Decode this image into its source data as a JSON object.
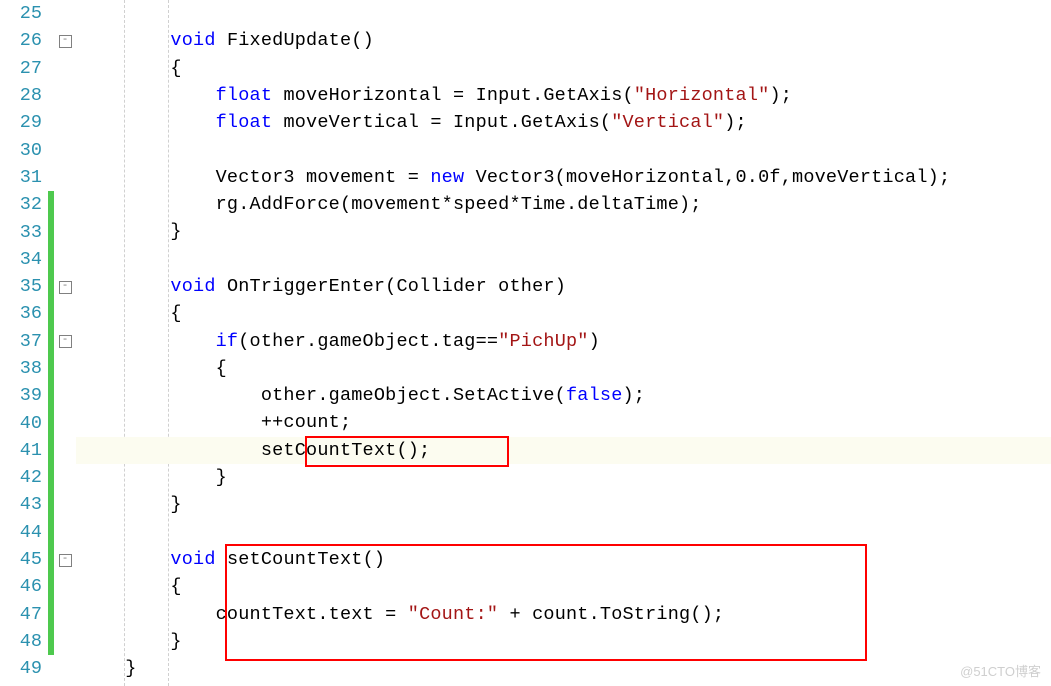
{
  "watermark": "@51CTO博客",
  "gutter": {
    "start": 25,
    "end": 49,
    "change_lines": [
      32,
      33,
      34,
      35,
      36,
      37,
      38,
      39,
      40,
      41,
      42,
      43,
      44,
      45,
      46,
      47,
      48
    ],
    "fold_lines": [
      26,
      35,
      37,
      45
    ]
  },
  "code": {
    "lines": [
      {
        "n": 25,
        "seg": [
          {
            "c": "norm",
            "t": ""
          }
        ]
      },
      {
        "n": 26,
        "seg": [
          {
            "c": "norm",
            "t": "        "
          },
          {
            "c": "kw",
            "t": "void"
          },
          {
            "c": "norm",
            "t": " FixedUpdate()"
          }
        ]
      },
      {
        "n": 27,
        "seg": [
          {
            "c": "norm",
            "t": "        {"
          }
        ]
      },
      {
        "n": 28,
        "seg": [
          {
            "c": "norm",
            "t": "            "
          },
          {
            "c": "kw",
            "t": "float"
          },
          {
            "c": "norm",
            "t": " moveHorizontal = Input.GetAxis("
          },
          {
            "c": "str",
            "t": "\"Horizontal\""
          },
          {
            "c": "norm",
            "t": ");"
          }
        ]
      },
      {
        "n": 29,
        "seg": [
          {
            "c": "norm",
            "t": "            "
          },
          {
            "c": "kw",
            "t": "float"
          },
          {
            "c": "norm",
            "t": " moveVertical = Input.GetAxis("
          },
          {
            "c": "str",
            "t": "\"Vertical\""
          },
          {
            "c": "norm",
            "t": ");"
          }
        ]
      },
      {
        "n": 30,
        "seg": [
          {
            "c": "norm",
            "t": ""
          }
        ]
      },
      {
        "n": 31,
        "seg": [
          {
            "c": "norm",
            "t": "            Vector3 movement = "
          },
          {
            "c": "kw",
            "t": "new"
          },
          {
            "c": "norm",
            "t": " Vector3(moveHorizontal,0.0f,moveVertical);"
          }
        ]
      },
      {
        "n": 32,
        "seg": [
          {
            "c": "norm",
            "t": "            rg.AddForce(movement*speed*Time.deltaTime);"
          }
        ]
      },
      {
        "n": 33,
        "seg": [
          {
            "c": "norm",
            "t": "        }"
          }
        ]
      },
      {
        "n": 34,
        "seg": [
          {
            "c": "norm",
            "t": ""
          }
        ]
      },
      {
        "n": 35,
        "seg": [
          {
            "c": "norm",
            "t": "        "
          },
          {
            "c": "kw",
            "t": "void"
          },
          {
            "c": "norm",
            "t": " OnTriggerEnter(Collider other)"
          }
        ]
      },
      {
        "n": 36,
        "seg": [
          {
            "c": "norm",
            "t": "        {"
          }
        ]
      },
      {
        "n": 37,
        "seg": [
          {
            "c": "norm",
            "t": "            "
          },
          {
            "c": "kw",
            "t": "if"
          },
          {
            "c": "norm",
            "t": "(other.gameObject.tag=="
          },
          {
            "c": "str",
            "t": "\"PichUp\""
          },
          {
            "c": "norm",
            "t": ")"
          }
        ]
      },
      {
        "n": 38,
        "seg": [
          {
            "c": "norm",
            "t": "            {"
          }
        ]
      },
      {
        "n": 39,
        "seg": [
          {
            "c": "norm",
            "t": "                other.gameObject.SetActive("
          },
          {
            "c": "kw",
            "t": "false"
          },
          {
            "c": "norm",
            "t": ");"
          }
        ]
      },
      {
        "n": 40,
        "seg": [
          {
            "c": "norm",
            "t": "                ++count;"
          }
        ]
      },
      {
        "n": 41,
        "seg": [
          {
            "c": "norm",
            "t": "                setCountText();"
          }
        ],
        "hl": true
      },
      {
        "n": 42,
        "seg": [
          {
            "c": "norm",
            "t": "            }"
          }
        ]
      },
      {
        "n": 43,
        "seg": [
          {
            "c": "norm",
            "t": "        }"
          }
        ]
      },
      {
        "n": 44,
        "seg": [
          {
            "c": "norm",
            "t": ""
          }
        ]
      },
      {
        "n": 45,
        "seg": [
          {
            "c": "norm",
            "t": "        "
          },
          {
            "c": "kw",
            "t": "void"
          },
          {
            "c": "norm",
            "t": " setCountText()"
          }
        ]
      },
      {
        "n": 46,
        "seg": [
          {
            "c": "norm",
            "t": "        {"
          }
        ]
      },
      {
        "n": 47,
        "seg": [
          {
            "c": "norm",
            "t": "            countText.text = "
          },
          {
            "c": "str",
            "t": "\"Count:\""
          },
          {
            "c": "norm",
            "t": " + count.ToString();"
          }
        ]
      },
      {
        "n": 48,
        "seg": [
          {
            "c": "norm",
            "t": "        }"
          }
        ]
      },
      {
        "n": 49,
        "seg": [
          {
            "c": "norm",
            "t": "    }"
          }
        ]
      }
    ]
  },
  "annotations": {
    "box1_desc": "setCountText-call-highlight",
    "box2_desc": "setCountText-method-highlight"
  }
}
